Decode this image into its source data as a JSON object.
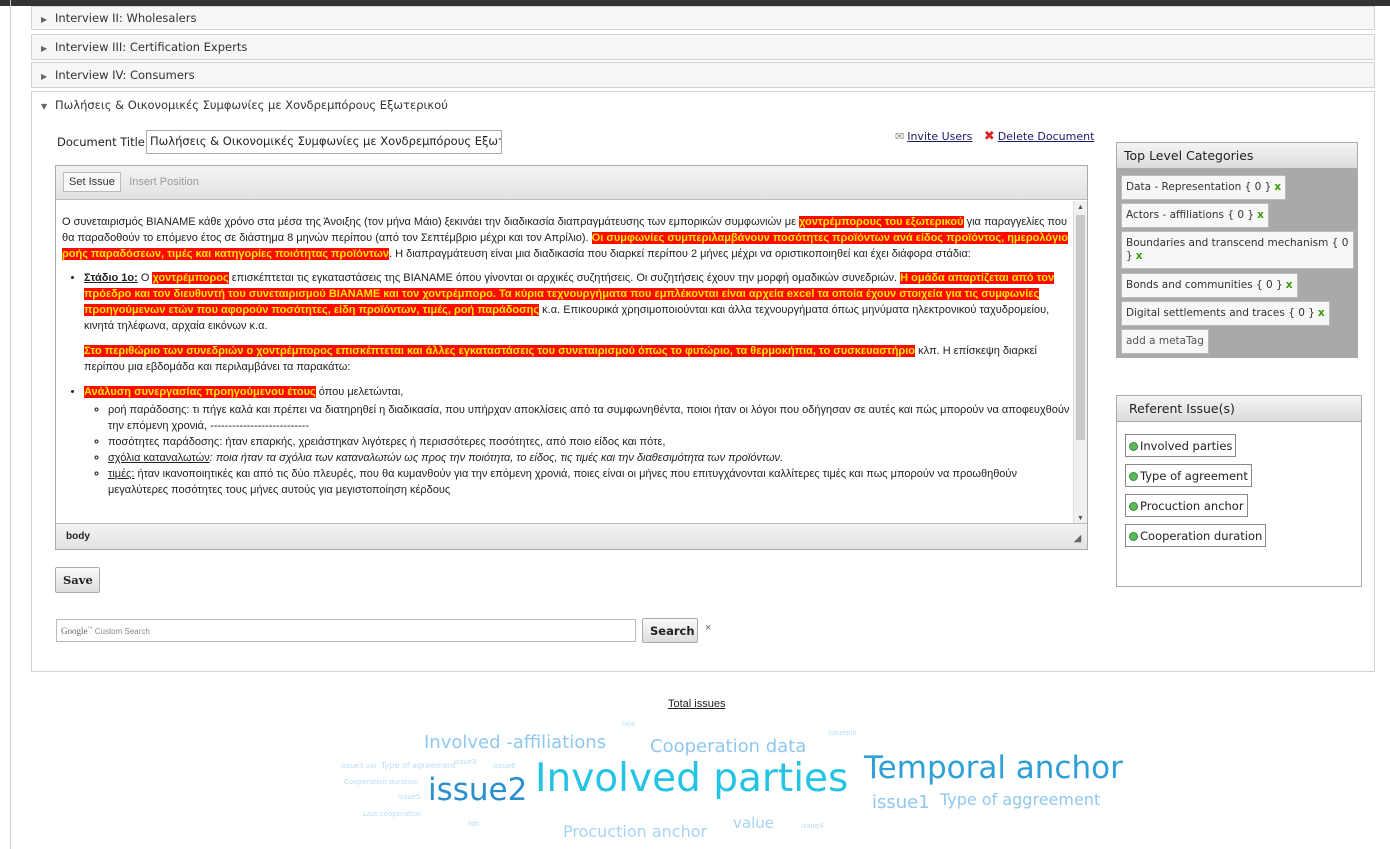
{
  "accordion": {
    "items": [
      {
        "label": "Interview II: Wholesalers"
      },
      {
        "label": "Interview III: Certification Experts"
      },
      {
        "label": "Interview IV: Consumers"
      },
      {
        "label": "Πωλήσεις & Οικονομικές Συμφωνίες με Χονδρεμπόρους Εξωτερικού"
      }
    ]
  },
  "document": {
    "title_label": "Document Title:",
    "title_value": "Πωλήσεις & Οικονομικές Συμφωνίες με Χονδρεμπόρους Εξωτερι",
    "invite_label": "Invite Users",
    "delete_label": "Delete Document"
  },
  "editor": {
    "toolbar": {
      "set_issue": "Set Issue",
      "insert_position": "Insert Position"
    },
    "status": "body",
    "p1": {
      "a": "Ο συνεταιρισμός ΒΙΑΝΑΜΕ κάθε χρόνο στα μέσα της Άνοιξης (τον μήνα Μάιο) ξεκινάει την διαδικασία διαπραγμάτευσης των εμπορικών συμφωνιών με ",
      "h1": "χοντρέμπορους του εξωτερικού",
      "b": " για παραγγελίες που θα παραδοθούν το επόμενο έτος σε διάστημα 8 μηνών περίπου (από τον Σεπτέμβριο μέχρι και τον Απρίλιο). ",
      "h2": "Οι συμφωνίες συμπεριλαμβάνουν ποσότητες προϊόντων ανά είδος προϊόντος, ημερολόγιο ροής παραδόσεων, τιμές και κατηγορίες ποιότητας προϊόντων",
      "c": ". Η διαπραγμάτευση είναι μια διαδικασία που διαρκεί περίπου 2 μήνες μέχρι να οριστικοποιηθεί και έχει διάφορα στάδια:"
    },
    "b1": {
      "stage": "Στάδιο 1ο:",
      "a": " Ο ",
      "h1": "χοντρέμπορος",
      "b": " επισκέπτεται τις εγκαταστάσεις της ΒΙΑΝΑΜΕ όπου γίνονται οι αρχικές  συζητήσεις. Οι συζητήσεις έχουν την μορφή ομαδικών συνεδριών. ",
      "h2": "Η ομάδα απαρτίζεται από τον πρόεδρο και τον διευθυντή του συνεταιρισμού ΒΙΑΝΑΜΕ και τον χοντρέμπορο. Τα κύρια τεχνουργήματα που εμπλέκονται είναι αρχεία excel τα οποία έχουν στοιχεία για τις συμφωνίες προηγούμενων ετών που αφορούν ποσότητες, είδη προϊόντων, τιμές, ροή παράδοσης",
      "c": " κ.α. Επικουρικά χρησιμοποιούνται και άλλα τεχνουργήματα όπως μηνύματα ηλεκτρονικού ταχυδρομείου, κινητά τηλέφωνα, αρχαία εικόνων κ.α."
    },
    "p2": {
      "h": "Στο περιθώριο των συνεδριών ο χοντρέμπορος επισκέπτεται και άλλες εγκαταστάσεις του συνεταιρισμού όπως το φυτώριο, τα θερμοκήπια, το συσκευαστήριο",
      "a": " κλπ. Η επίσκεψη διαρκεί περίπου μια εβδομάδα και περιλαμβάνει τα παρακάτω:"
    },
    "b2": {
      "h": "Ανάλυση συνεργασίας προηγούμενου έτους",
      "a": " όπου μελετώνται,",
      "sub1": "ροή παράδοσης: τι πήγε καλά και πρέπει να διατηρηθεί η διαδικασία, που υπήρχαν αποκλίσεις από τα συμφωνηθέντα, ποιοι ήταν οι λόγοι που οδήγησαν σε αυτές και πώς μπορούν να αποφευχθούν την επόμενη χρονιά,  ---------------------------",
      "sub2": "ποσότητες παράδοσης: ήταν επαρκής, χρειάστηκαν λιγότερες ή περισσότερες ποσότητες, από ποιο είδος και πότε,",
      "sub3_u": "σχόλια καταναλωτών",
      "sub3": ": ποια ήταν τα σχόλια των καταναλωτών ως προς την ποιότητα, το είδος, τις τιμές και την διαθεσιμότητα των προϊόντων.",
      "sub4_u": "τιμές:",
      "sub4": " ήταν ικανοποιητικές και από τις δύο πλευρές, που θα κυμανθούν για την επόμενη χρονιά, ποιες είναι οι μήνες που επιτυγχάνονται καλλίτερες τιμές και πως μπορούν να προωθηθούν μεγαλύτερες ποσότητες τους μήνες αυτούς για μεγιστοποίηση κέρδους"
    }
  },
  "save_label": "Save",
  "search": {
    "brand": "Google",
    "placeholder": "Custom Search",
    "button": "Search",
    "close": "×"
  },
  "top_level": {
    "title": "Top Level Categories",
    "tags": [
      {
        "label": "Data - Representation { 0 }"
      },
      {
        "label": "Actors - affiliations { 0 }"
      },
      {
        "label": "Boundaries and transcend mechanism { 0 }"
      },
      {
        "label": "Bonds and communities { 0 }"
      },
      {
        "label": "Digital settlements and traces { 0 }"
      }
    ],
    "remove_mark": "x",
    "add_label": "add a metaTag"
  },
  "referent": {
    "title": "Referent Issue(s)",
    "items": [
      {
        "label": "Involved parties"
      },
      {
        "label": "Type of agreement"
      },
      {
        "label": "Procuction anchor"
      },
      {
        "label": "Cooperation duration"
      }
    ]
  },
  "cloud": {
    "title": "Total issues",
    "words": [
      {
        "text": "Involved parties",
        "color": "#25c4e4"
      },
      {
        "text": "Temporal anchor",
        "color": "#2e9fd8"
      },
      {
        "text": "issue2",
        "color": "#2a8fcf"
      },
      {
        "text": "Involved -affiliations",
        "color": "#8fc8ee"
      },
      {
        "text": "Cooperation data",
        "color": "#8fc8ee"
      },
      {
        "text": "issue1",
        "color": "#8fc8ee"
      },
      {
        "text": "Type of aggreement",
        "color": "#8fc8ee"
      },
      {
        "text": "Procuction anchor",
        "color": "#a6d4f2"
      },
      {
        "text": "value",
        "color": "#a6d4f2"
      },
      {
        "text": "lala",
        "color": "#b8dcf4"
      },
      {
        "text": "issuepol",
        "color": "#b8dcf4"
      },
      {
        "text": "issue3 val",
        "color": "#b8dcf4"
      },
      {
        "text": "Type of agreement",
        "color": "#b8dcf4"
      },
      {
        "text": "issue3",
        "color": "#b8dcf4"
      },
      {
        "text": "issue6",
        "color": "#b8dcf4"
      },
      {
        "text": "Cooperation duration",
        "color": "#b8dcf4"
      },
      {
        "text": "issue5",
        "color": "#b8dcf4"
      },
      {
        "text": "Last cooperation",
        "color": "#b8dcf4"
      },
      {
        "text": "fdh",
        "color": "#b8dcf4"
      },
      {
        "text": "issue4",
        "color": "#b8dcf4"
      }
    ]
  }
}
